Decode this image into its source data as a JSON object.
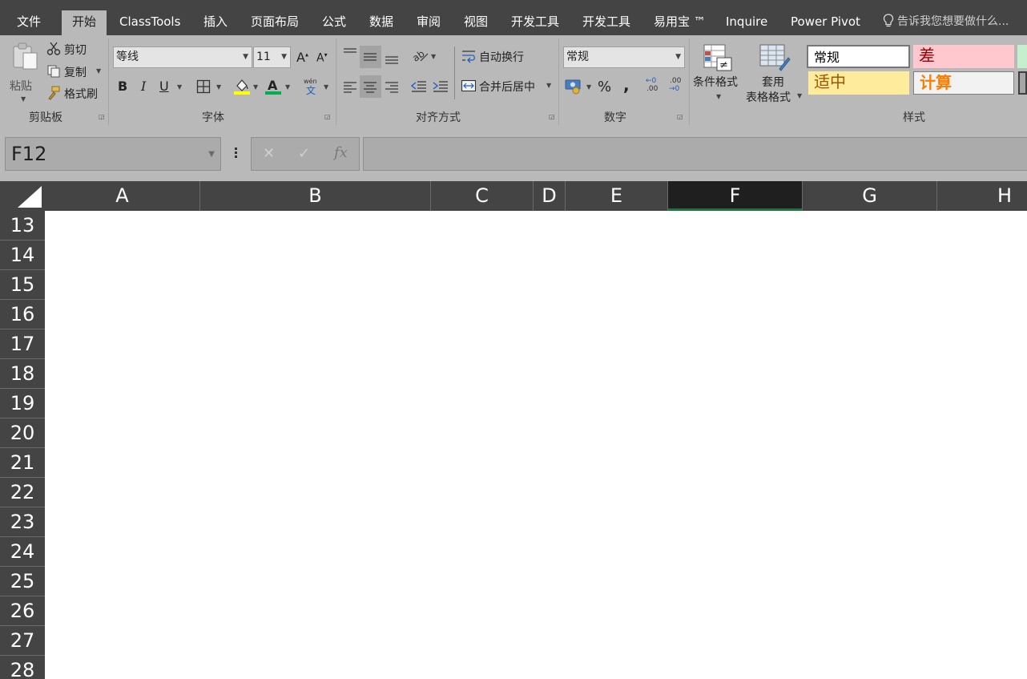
{
  "tabs": [
    "文件",
    "开始",
    "ClassTools",
    "插入",
    "页面布局",
    "公式",
    "数据",
    "审阅",
    "视图",
    "开发工具",
    "开发工具",
    "易用宝 ™",
    "Inquire",
    "Power Pivot"
  ],
  "active_tab": "开始",
  "tell_me": "告诉我您想要做什么...",
  "clipboard": {
    "paste": "粘贴",
    "cut": "剪切",
    "copy": "复制",
    "format_painter": "格式刷",
    "group_name": "剪贴板"
  },
  "font": {
    "family": "等线",
    "size": "11",
    "bold": "B",
    "italic": "I",
    "underline": "U",
    "group_name": "字体"
  },
  "alignment": {
    "wrap_text": "自动换行",
    "merge_center": "合并后居中",
    "group_name": "对齐方式"
  },
  "number": {
    "format": "常规",
    "percent": "%",
    "comma": ",",
    "increase_decimal": ".00",
    "decrease_decimal": ".00",
    "group_name": "数字"
  },
  "styles": {
    "conditional_format": "条件格式",
    "table_format_line1": "套用",
    "table_format_line2": "表格格式",
    "cell_styles": [
      {
        "label": "常规",
        "bg": "#ffffff",
        "fg": "#000000"
      },
      {
        "label": "差",
        "bg": "#ffc7ce",
        "fg": "#9c0006"
      },
      {
        "label": "适中",
        "bg": "#ffeb9c",
        "fg": "#9c5700"
      },
      {
        "label": "计算",
        "bg": "#f2f2f2",
        "fg": "#fa7d00"
      }
    ],
    "group_name": "样式"
  },
  "formula_bar": {
    "name_box": "F12",
    "cancel": "✕",
    "enter": "✓",
    "fx": "fx",
    "formula": ""
  },
  "columns": [
    "A",
    "B",
    "C",
    "D",
    "E",
    "F",
    "G",
    "H"
  ],
  "selected_column": "F",
  "rows": [
    "13",
    "14",
    "15",
    "16",
    "17",
    "18",
    "19",
    "20",
    "21",
    "22",
    "23",
    "24",
    "25",
    "26",
    "27",
    "28"
  ],
  "colors": {
    "accent_green": "#217346",
    "dark_bg": "#444444",
    "ribbon_bg": "#b9b9b9"
  }
}
